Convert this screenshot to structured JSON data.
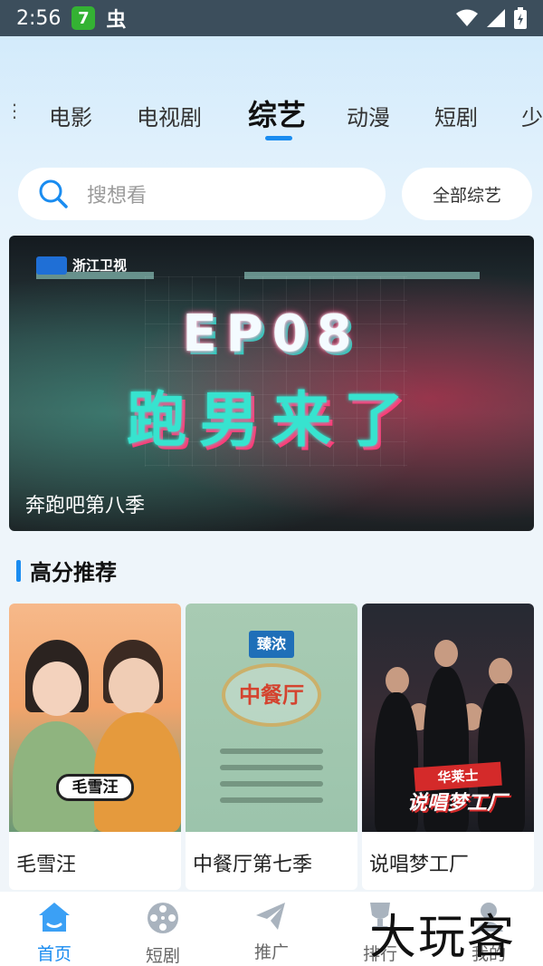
{
  "status_bar": {
    "time": "2:56",
    "app_badge": "7",
    "bug_glyph": "虫"
  },
  "tabs": [
    {
      "label": "电影",
      "active": false
    },
    {
      "label": "电视剧",
      "active": false
    },
    {
      "label": "综艺",
      "active": true
    },
    {
      "label": "动漫",
      "active": false
    },
    {
      "label": "短剧",
      "active": false
    },
    {
      "label": "少",
      "active": false
    }
  ],
  "search": {
    "placeholder": "搜想看",
    "all_button": "全部综艺"
  },
  "banner": {
    "channel": "浙江卫视",
    "title_line1": "EP08",
    "title_line2": "跑男来了",
    "caption": "奔跑吧第八季"
  },
  "section": {
    "title": "高分推荐"
  },
  "cards": [
    {
      "title": "毛雪汪",
      "poster_text": "毛雪汪"
    },
    {
      "title": "中餐厅第七季",
      "poster_brand": "臻浓",
      "poster_text": "中餐厅"
    },
    {
      "title": "说唱梦工厂",
      "poster_brand": "华莱士",
      "poster_text": "说唱梦工厂"
    }
  ],
  "bottom_nav": [
    {
      "label": "首页",
      "icon": "home-icon",
      "active": true
    },
    {
      "label": "短剧",
      "icon": "film-reel-icon",
      "active": false
    },
    {
      "label": "推广",
      "icon": "paper-plane-icon",
      "active": false
    },
    {
      "label": "排行",
      "icon": "trophy-icon",
      "active": false
    },
    {
      "label": "我的",
      "icon": "user-icon",
      "active": false
    }
  ],
  "watermark": "大玩客",
  "colors": {
    "accent": "#1a8cf0",
    "status_bar": "#3c4e5c"
  }
}
